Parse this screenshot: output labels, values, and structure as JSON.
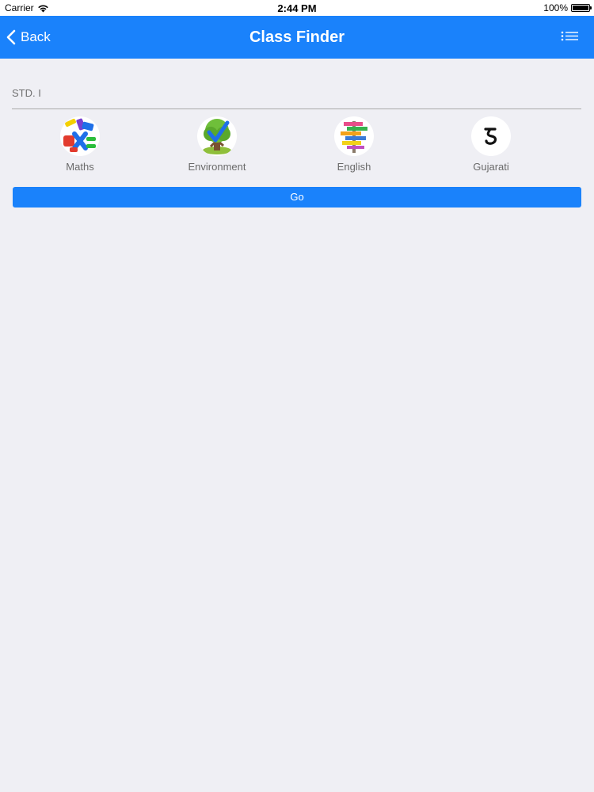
{
  "status_bar": {
    "carrier": "Carrier",
    "time": "2:44 PM",
    "battery": "100%",
    "battery_level": 1.0
  },
  "nav": {
    "back_label": "Back",
    "title": "Class Finder",
    "menu_icon": "list-icon",
    "color": "#1a82fb"
  },
  "class_selector": {
    "value": "STD. I"
  },
  "subjects": [
    {
      "label": "Maths",
      "icon": "maths-puzzle-icon"
    },
    {
      "label": "Environment",
      "icon": "tree-icon"
    },
    {
      "label": "English",
      "icon": "signpost-icon"
    },
    {
      "label": "Gujarati",
      "icon": "gujarati-letter-icon"
    }
  ],
  "go_button": {
    "label": "Go",
    "color": "#1a82fb"
  },
  "background_color": "#efeff4"
}
